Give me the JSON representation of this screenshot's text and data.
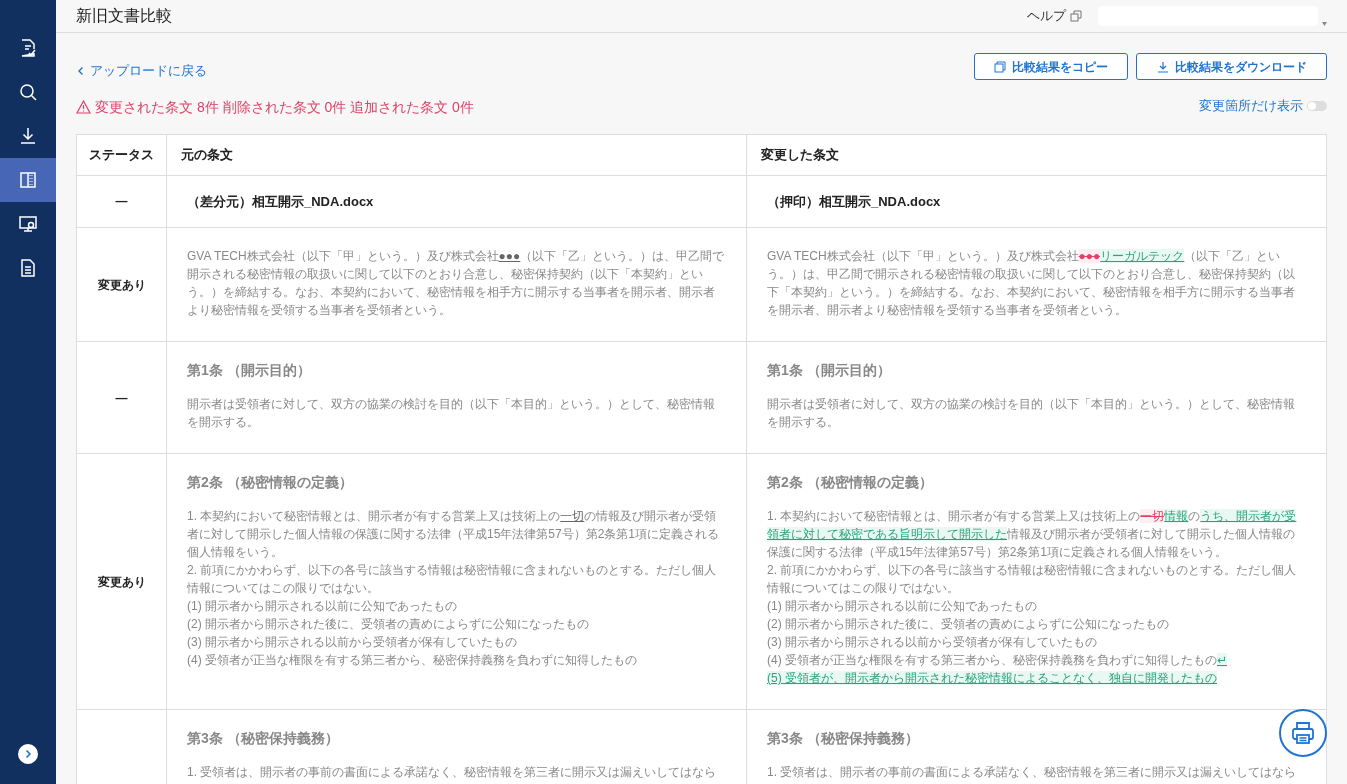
{
  "header": {
    "title": "新旧文書比較",
    "help": "ヘルプ"
  },
  "sidebar": {
    "items": [
      {
        "kind": "review",
        "selected": false
      },
      {
        "kind": "search",
        "selected": false
      },
      {
        "kind": "download",
        "selected": false
      },
      {
        "kind": "compare",
        "selected": true
      },
      {
        "kind": "monitor",
        "selected": false
      },
      {
        "kind": "document",
        "selected": false
      }
    ]
  },
  "back_link": "アップロードに戻る",
  "summary": "変更された条文 8件 削除された条文 0件 追加された条文 0件",
  "buttons": [
    {
      "label": "比較結果をコピー",
      "kind": "copy"
    },
    {
      "label": "比較結果をダウンロード",
      "kind": "download"
    }
  ],
  "toggle": {
    "label": "変更箇所だけ表示",
    "on": false
  },
  "table": {
    "columns": [
      "ステータス",
      "元の条文",
      "変更した条文"
    ],
    "rows": [
      {
        "kind": "file",
        "status": "—",
        "original": "（差分元）相互開示_NDA.docx",
        "revised": "（押印）相互開示_NDA.docx"
      },
      {
        "kind": "clause",
        "status": "変更あり",
        "original": {
          "lines": [
            [
              {
                "kind": "plain",
                "text": "GVA TECH株式会社（以下「甲」という。）及び株式会社"
              },
              {
                "kind": "marked",
                "text": "●●●"
              },
              {
                "kind": "plain",
                "text": "（以下「乙」という。）は、甲乙間で開示される秘密情報の取扱いに関して以下のとおり合意し、秘密保持契約（以下「本契約」という。）を締結する。なお、本契約において、秘密情報を相手方に開示する当事者を開示者、開示者より秘密情報を受領する当事者を受領者という。"
              }
            ]
          ]
        },
        "revised": {
          "lines": [
            [
              {
                "kind": "plain",
                "text": "GVA TECH株式会社（以下「甲」という。）及び株式会社"
              },
              {
                "kind": "deleted",
                "text": "●●●"
              },
              {
                "kind": "inserted",
                "text": "リーガルテック"
              },
              {
                "kind": "plain",
                "text": "（以下「乙」という。）は、甲乙間で開示される秘密情報の取扱いに関して以下のとおり合意し、秘密保持契約（以下「本契約」という。）を締結する。なお、本契約において、秘密情報を相手方に開示する当事者を開示者、開示者より秘密情報を受領する当事者を受領者という。"
              }
            ]
          ]
        }
      },
      {
        "kind": "clause",
        "status": "—",
        "original": {
          "heading": "第1条 （開示目的）",
          "lines": [
            [
              {
                "kind": "plain",
                "text": "開示者は受領者に対して、双方の協業の検討を目的（以下「本目的」という。）として、秘密情報を開示する。"
              }
            ]
          ]
        },
        "revised": {
          "heading": "第1条 （開示目的）",
          "lines": [
            [
              {
                "kind": "plain",
                "text": "開示者は受領者に対して、双方の協業の検討を目的（以下「本目的」という。）として、秘密情報を開示する。"
              }
            ]
          ]
        }
      },
      {
        "kind": "clause",
        "status": "変更あり",
        "original": {
          "heading": "第2条 （秘密情報の定義）",
          "lines": [
            [
              {
                "kind": "plain",
                "text": "1. 本契約において秘密情報とは、開示者が有する営業上又は技術上の"
              },
              {
                "kind": "marked",
                "text": "一切"
              },
              {
                "kind": "plain",
                "text": "の情報及び開示者が受領者に対して開示した個人情報の保護に関する法律（平成15年法律第57号）第2条第1項に定義される個人情報をいう。"
              }
            ],
            [
              {
                "kind": "plain",
                "text": "2. 前項にかかわらず、以下の各号に該当する情報は秘密情報に含まれないものとする。ただし個人情報についてはこの限りではない。"
              }
            ],
            [
              {
                "kind": "plain",
                "text": "(1) 開示者から開示される以前に公知であったもの"
              }
            ],
            [
              {
                "kind": "plain",
                "text": "(2) 開示者から開示された後に、受領者の責めによらずに公知になったもの"
              }
            ],
            [
              {
                "kind": "plain",
                "text": "(3) 開示者から開示される以前から受領者が保有していたもの"
              }
            ],
            [
              {
                "kind": "plain",
                "text": "(4) 受領者が正当な権限を有する第三者から、秘密保持義務を負わずに知得したもの"
              }
            ]
          ]
        },
        "revised": {
          "heading": "第2条 （秘密情報の定義）",
          "lines": [
            [
              {
                "kind": "plain",
                "text": "1. 本契約において秘密情報とは、開示者が有する営業上又は技術上の"
              },
              {
                "kind": "deleted",
                "text": "一切"
              },
              {
                "kind": "inserted",
                "text": "情報"
              },
              {
                "kind": "plain",
                "text": "の"
              },
              {
                "kind": "inserted",
                "text": "うち、開示者が受領者に対して秘密である旨明示して開示した"
              },
              {
                "kind": "plain",
                "text": "情報及び開示者が受領者に対して開示した個人情報の保護に関する法律（平成15年法律第57号）第2条第1項に定義される個人情報をいう。"
              }
            ],
            [
              {
                "kind": "plain",
                "text": "2. 前項にかかわらず、以下の各号に該当する情報は秘密情報に含まれないものとする。ただし個人情報についてはこの限りではない。"
              }
            ],
            [
              {
                "kind": "plain",
                "text": "(1) 開示者から開示される以前に公知であったもの"
              }
            ],
            [
              {
                "kind": "plain",
                "text": "(2) 開示者から開示された後に、受領者の責めによらずに公知になったもの"
              }
            ],
            [
              {
                "kind": "plain",
                "text": "(3) 開示者から開示される以前から受領者が保有していたもの"
              }
            ],
            [
              {
                "kind": "plain",
                "text": "(4) 受領者が正当な権限を有する第三者から、秘密保持義務を負わずに知得したもの"
              },
              {
                "kind": "inserted",
                "text": "↵"
              }
            ],
            [
              {
                "kind": "inserted",
                "text": "(5) 受領者が、開示者から開示された秘密情報によることなく、独自に開発したもの"
              }
            ]
          ]
        }
      },
      {
        "kind": "clause",
        "original": {
          "heading": "第3条 （秘密保持義務）",
          "lines": [
            [
              {
                "kind": "plain",
                "text": "1. 受領者は、開示者の事前の書面による承諾なく、秘密情報を第三者に開示又は漏えいしてはなら"
              }
            ]
          ]
        },
        "revised": {
          "heading": "第3条 （秘密保持義務）",
          "lines": [
            [
              {
                "kind": "plain",
                "text": "1. 受領者は、開示者の事前の書面による承諾なく、秘密情報を第三者に開示又は漏えいしてはなら"
              }
            ]
          ]
        }
      }
    ]
  }
}
